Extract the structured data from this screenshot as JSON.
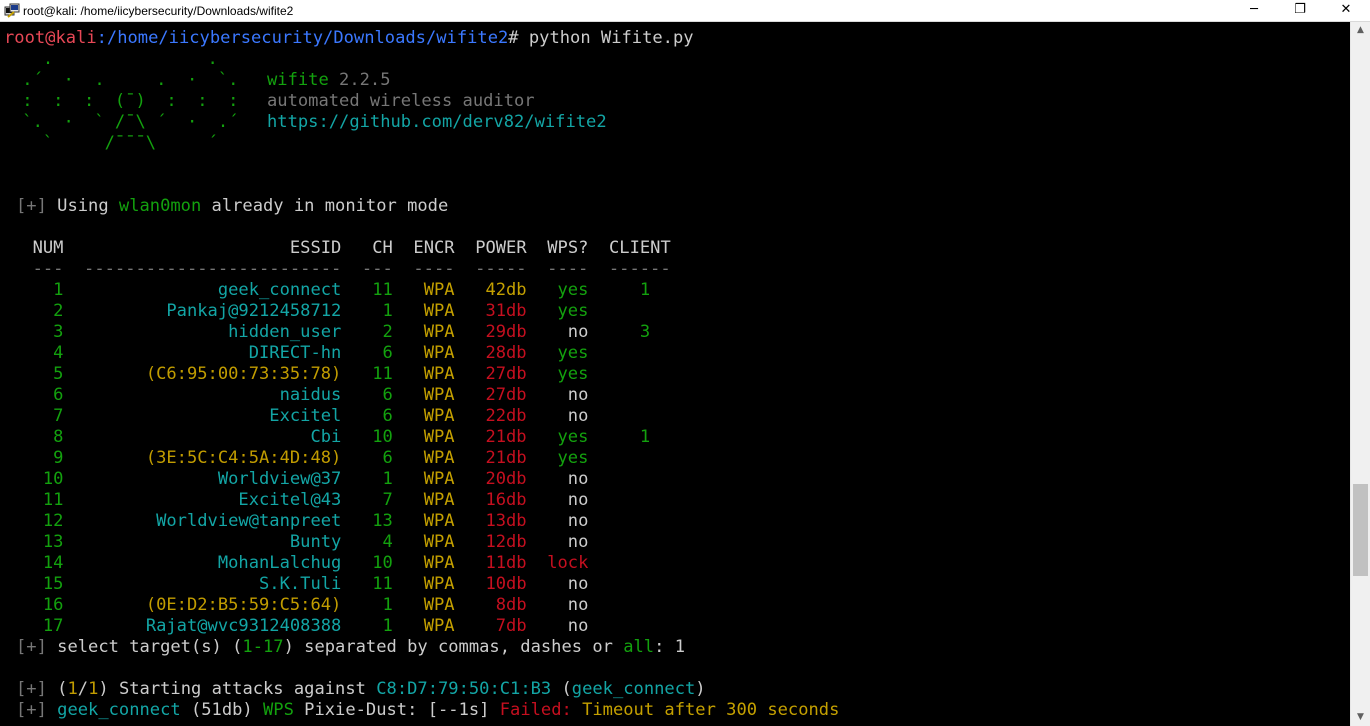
{
  "window": {
    "title": "root@kali: /home/iicybersecurity/Downloads/wifite2",
    "minimize": "─",
    "maximize": "❐",
    "close": "✕"
  },
  "prompt": {
    "user": "root@kali",
    "path": ":/home/iicybersecurity/Downloads/wifite2",
    "symbol": "#",
    "command": " python Wifite.py"
  },
  "banner": {
    "art": [
      "   .               .    ",
      " .´  ·  .     .  ·  `.  ",
      " :  :  :  (¯)  :  :  :  ",
      " `.  ·  ` /¯\\ ´  ·  .´  ",
      "   `     /¯¯¯\\     ´    "
    ],
    "name": "wifite",
    "version": "2.2.5",
    "tagline": "automated wireless auditor",
    "url": "https://github.com/derv82/wifite2"
  },
  "monitor": {
    "prefix": "[+]",
    "text1": " Using ",
    "iface": "wlan0mon",
    "text2": " already in monitor mode"
  },
  "table": {
    "headers": [
      "NUM",
      "ESSID",
      "CH",
      "ENCR",
      "POWER",
      "WPS?",
      "CLIENT"
    ],
    "rule": "  ---  -------------------------  ---  ----  -----  ----  ------",
    "rows": [
      {
        "num": "1",
        "essid": "geek_connect",
        "ch": "11",
        "encr": "WPA",
        "power": "42db",
        "wps": "yes",
        "client": "1",
        "hidden": false,
        "strong": true
      },
      {
        "num": "2",
        "essid": "Pankaj@9212458712",
        "ch": "1",
        "encr": "WPA",
        "power": "31db",
        "wps": "yes",
        "client": "",
        "hidden": false,
        "strong": false
      },
      {
        "num": "3",
        "essid": "hidden_user",
        "ch": "2",
        "encr": "WPA",
        "power": "29db",
        "wps": "no",
        "client": "3",
        "hidden": false,
        "strong": false
      },
      {
        "num": "4",
        "essid": "DIRECT-hn",
        "ch": "6",
        "encr": "WPA",
        "power": "28db",
        "wps": "yes",
        "client": "",
        "hidden": false,
        "strong": false
      },
      {
        "num": "5",
        "essid": "(C6:95:00:73:35:78)",
        "ch": "11",
        "encr": "WPA",
        "power": "27db",
        "wps": "yes",
        "client": "",
        "hidden": true,
        "strong": false
      },
      {
        "num": "6",
        "essid": "naidus",
        "ch": "6",
        "encr": "WPA",
        "power": "27db",
        "wps": "no",
        "client": "",
        "hidden": false,
        "strong": false
      },
      {
        "num": "7",
        "essid": "Excitel",
        "ch": "6",
        "encr": "WPA",
        "power": "22db",
        "wps": "no",
        "client": "",
        "hidden": false,
        "strong": false
      },
      {
        "num": "8",
        "essid": "Cbi",
        "ch": "10",
        "encr": "WPA",
        "power": "21db",
        "wps": "yes",
        "client": "1",
        "hidden": false,
        "strong": false
      },
      {
        "num": "9",
        "essid": "(3E:5C:C4:5A:4D:48)",
        "ch": "6",
        "encr": "WPA",
        "power": "21db",
        "wps": "yes",
        "client": "",
        "hidden": true,
        "strong": false
      },
      {
        "num": "10",
        "essid": "Worldview@37",
        "ch": "1",
        "encr": "WPA",
        "power": "20db",
        "wps": "no",
        "client": "",
        "hidden": false,
        "strong": false
      },
      {
        "num": "11",
        "essid": "Excitel@43",
        "ch": "7",
        "encr": "WPA",
        "power": "16db",
        "wps": "no",
        "client": "",
        "hidden": false,
        "strong": false
      },
      {
        "num": "12",
        "essid": "Worldview@tanpreet",
        "ch": "13",
        "encr": "WPA",
        "power": "13db",
        "wps": "no",
        "client": "",
        "hidden": false,
        "strong": false
      },
      {
        "num": "13",
        "essid": "Bunty",
        "ch": "4",
        "encr": "WPA",
        "power": "12db",
        "wps": "no",
        "client": "",
        "hidden": false,
        "strong": false
      },
      {
        "num": "14",
        "essid": "MohanLalchug",
        "ch": "10",
        "encr": "WPA",
        "power": "11db",
        "wps": "lock",
        "client": "",
        "hidden": false,
        "strong": false
      },
      {
        "num": "15",
        "essid": "S.K.Tuli",
        "ch": "11",
        "encr": "WPA",
        "power": "10db",
        "wps": "no",
        "client": "",
        "hidden": false,
        "strong": false
      },
      {
        "num": "16",
        "essid": "(0E:D2:B5:59:C5:64)",
        "ch": "1",
        "encr": "WPA",
        "power": "8db",
        "wps": "no",
        "client": "",
        "hidden": true,
        "strong": false
      },
      {
        "num": "17",
        "essid": "Rajat@wvc9312408388",
        "ch": "1",
        "encr": "WPA",
        "power": "7db",
        "wps": "no",
        "client": "",
        "hidden": false,
        "strong": false
      }
    ]
  },
  "select": {
    "prefix": "[+]",
    "text1": " select target(s) (",
    "range": "1-17",
    "text2": ") separated by commas, dashes or ",
    "all": "all",
    "text3": ": ",
    "input": "1"
  },
  "attack": {
    "prefix": "[+]",
    "open": " (",
    "cur": "1",
    "slash": "/",
    "total": "1",
    "text1": ") Starting attacks against ",
    "bssid": "C8:D7:79:50:C1:B3",
    "paren_open": " (",
    "essid": "geek_connect",
    "paren_close": ")"
  },
  "status": {
    "prefix": "[+]",
    "essid": " geek_connect",
    "power": " (51db)",
    "wps": " WPS",
    "pixie": " Pixie-Dust",
    "timer": ": [--1s] ",
    "failed": "Failed:",
    "reason": " Timeout after 300 seconds"
  },
  "scrollbar": {
    "up": "▲",
    "down": "▼",
    "position": 0.9
  }
}
